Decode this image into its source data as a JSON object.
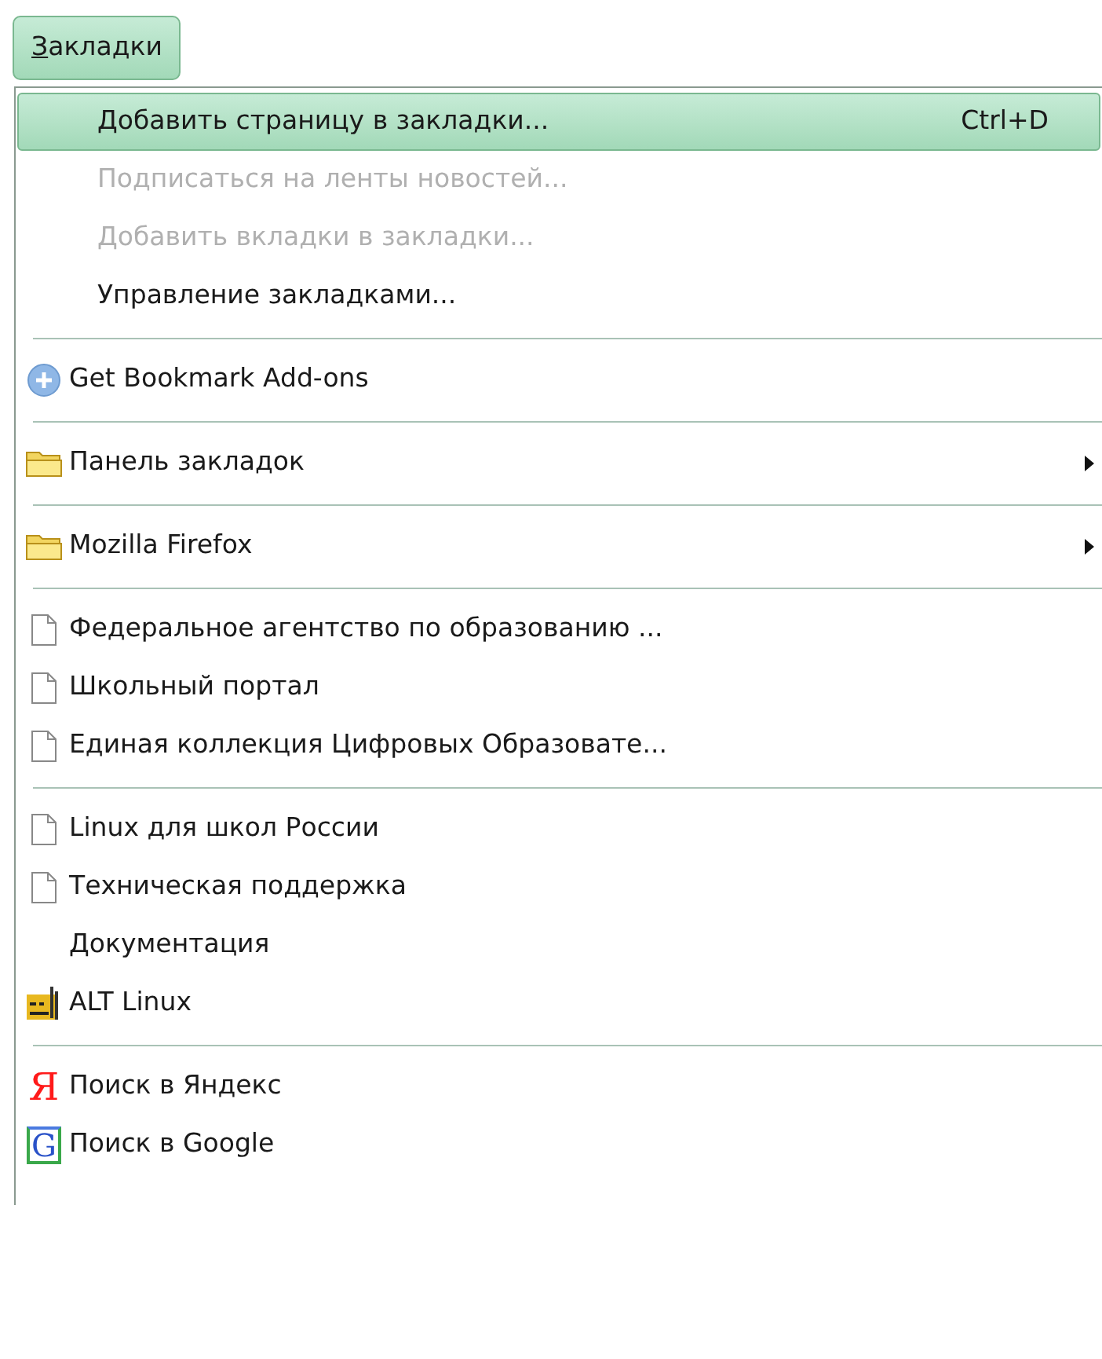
{
  "menubar": {
    "label": "Закладки",
    "selected": true
  },
  "menu": {
    "items": [
      {
        "kind": "action",
        "label": "Добавить страницу в закладки...",
        "shortcut": "Ctrl+D",
        "selected": true,
        "disabled": false
      },
      {
        "kind": "action",
        "label": "Подписаться на ленты новостей...",
        "selected": false,
        "disabled": true
      },
      {
        "kind": "action",
        "label": "Добавить вкладки в закладки...",
        "selected": false,
        "disabled": true
      },
      {
        "kind": "action",
        "label": "Управление закладками...",
        "selected": false,
        "disabled": false
      },
      {
        "kind": "separator"
      },
      {
        "kind": "addons",
        "label": "Get Bookmark Add-ons"
      },
      {
        "kind": "separator"
      },
      {
        "kind": "folder",
        "label": "Панель закладок",
        "submenu": true
      },
      {
        "kind": "separator"
      },
      {
        "kind": "folder",
        "label": "Mozilla Firefox",
        "submenu": true
      },
      {
        "kind": "separator"
      },
      {
        "kind": "page",
        "label": "Федеральное агентство по образованию ..."
      },
      {
        "kind": "page",
        "label": "Школьный портал"
      },
      {
        "kind": "page",
        "label": "Единая коллекция Цифровых Образовате..."
      },
      {
        "kind": "separator"
      },
      {
        "kind": "page",
        "label": "Linux для школ России"
      },
      {
        "kind": "page",
        "label": "Техническая поддержка"
      },
      {
        "kind": "blank",
        "label": "Документация"
      },
      {
        "kind": "alt",
        "label": "ALT Linux"
      },
      {
        "kind": "separator"
      },
      {
        "kind": "yandex",
        "label": "Поиск в Яндекс",
        "glyph": "Я"
      },
      {
        "kind": "google",
        "label": "Поиск в Google",
        "glyph": "G"
      }
    ]
  }
}
